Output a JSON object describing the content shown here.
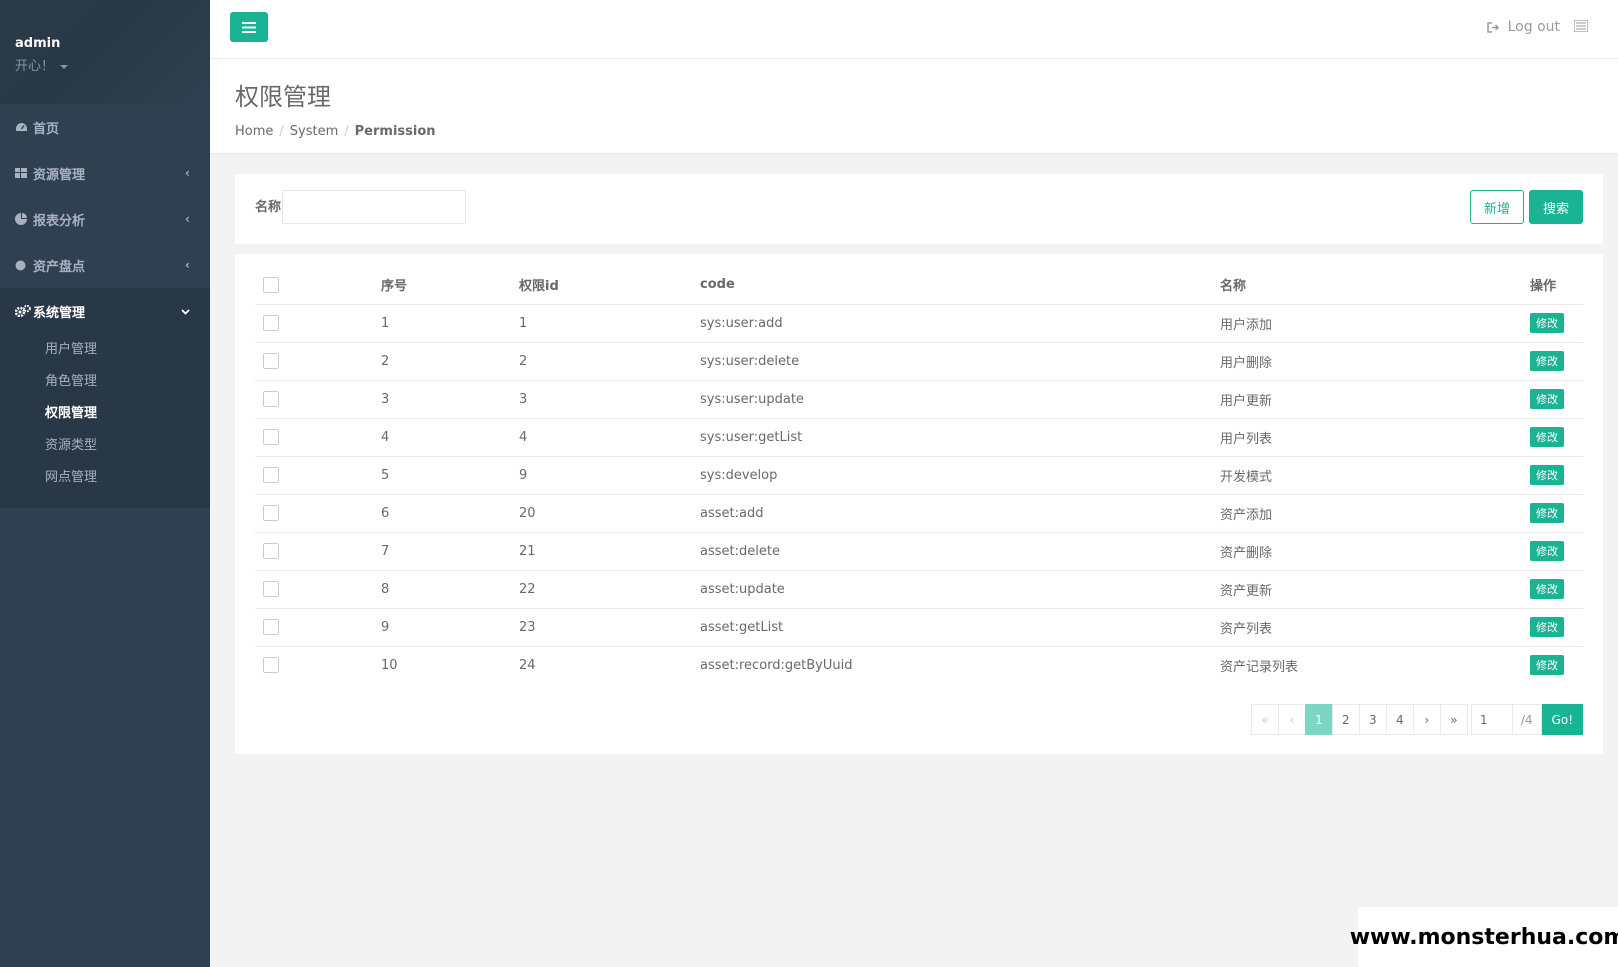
{
  "sidebar": {
    "user_name": "admin",
    "motto": "开心！",
    "items": [
      {
        "label": "首页",
        "icon": "dashboard-icon"
      },
      {
        "label": "资源管理",
        "icon": "grid-icon"
      },
      {
        "label": "报表分析",
        "icon": "pie-chart-icon"
      },
      {
        "label": "资产盘点",
        "icon": "circle-icon"
      },
      {
        "label": "系统管理",
        "icon": "gears-icon"
      }
    ],
    "sub_items": [
      {
        "label": "用户管理"
      },
      {
        "label": "角色管理"
      },
      {
        "label": "权限管理"
      },
      {
        "label": "资源类型"
      },
      {
        "label": "网点管理"
      }
    ]
  },
  "topbar": {
    "logout_label": "Log out"
  },
  "heading": {
    "title": "权限管理",
    "breadcrumb": [
      "Home",
      "System",
      "Permission"
    ]
  },
  "search": {
    "label": "名称",
    "value": "",
    "add_label": "新增",
    "search_label": "搜索"
  },
  "table": {
    "headers": [
      "序号",
      "权限id",
      "code",
      "名称",
      "操作"
    ],
    "edit_label": "修改",
    "rows": [
      {
        "seq": "1",
        "id": "1",
        "code": "sys:user:add",
        "name": "用户添加"
      },
      {
        "seq": "2",
        "id": "2",
        "code": "sys:user:delete",
        "name": "用户删除"
      },
      {
        "seq": "3",
        "id": "3",
        "code": "sys:user:update",
        "name": "用户更新"
      },
      {
        "seq": "4",
        "id": "4",
        "code": "sys:user:getList",
        "name": "用户列表"
      },
      {
        "seq": "5",
        "id": "9",
        "code": "sys:develop",
        "name": "开发模式"
      },
      {
        "seq": "6",
        "id": "20",
        "code": "asset:add",
        "name": "资产添加"
      },
      {
        "seq": "7",
        "id": "21",
        "code": "asset:delete",
        "name": "资产删除"
      },
      {
        "seq": "8",
        "id": "22",
        "code": "asset:update",
        "name": "资产更新"
      },
      {
        "seq": "9",
        "id": "23",
        "code": "asset:getList",
        "name": "资产列表"
      },
      {
        "seq": "10",
        "id": "24",
        "code": "asset:record:getByUuid",
        "name": "资产记录列表"
      }
    ]
  },
  "pagination": {
    "first": "«",
    "prev": "‹",
    "pages": [
      "1",
      "2",
      "3",
      "4"
    ],
    "current": "1",
    "next": "›",
    "last": "»",
    "jump_value": "1",
    "total": "/4",
    "go_label": "Go!"
  },
  "watermark": "www.monsterhua.com",
  "colors": {
    "sidebar_bg": "#2f4050",
    "accent": "#1ab394"
  }
}
